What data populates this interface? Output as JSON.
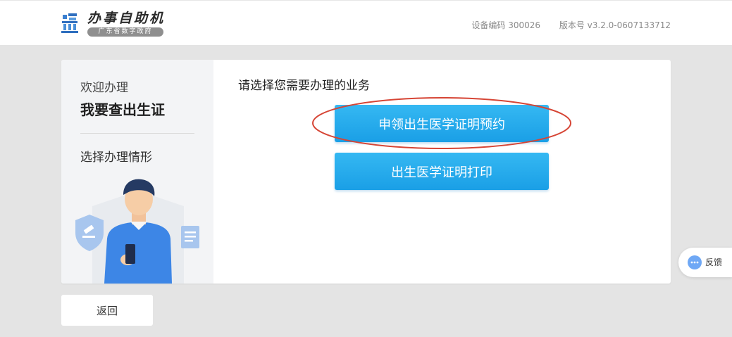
{
  "header": {
    "app_title": "办事自助机",
    "app_subtitle": "广东省数字政府",
    "device_code": "设备编码 300026",
    "version": "版本号 v3.2.0-0607133712",
    "logo_icon": "gov-building-logo-icon"
  },
  "sidebar": {
    "welcome": "欢迎办理",
    "service_name": "我要查出生证",
    "step_label": "选择办理情形",
    "illustration": "person-with-phone-illustration"
  },
  "content": {
    "prompt": "请选择您需要办理的业务",
    "options": [
      {
        "label": "申领出生医学证明预约",
        "highlighted": true
      },
      {
        "label": "出生医学证明打印",
        "highlighted": false
      }
    ]
  },
  "footer": {
    "back_label": "返回"
  },
  "feedback": {
    "label": "反馈",
    "icon": "chat-bubble-icon"
  },
  "colors": {
    "primary_button": "#1a9fe6",
    "highlight_ellipse": "#d64535",
    "page_background": "#e4e4e4"
  }
}
